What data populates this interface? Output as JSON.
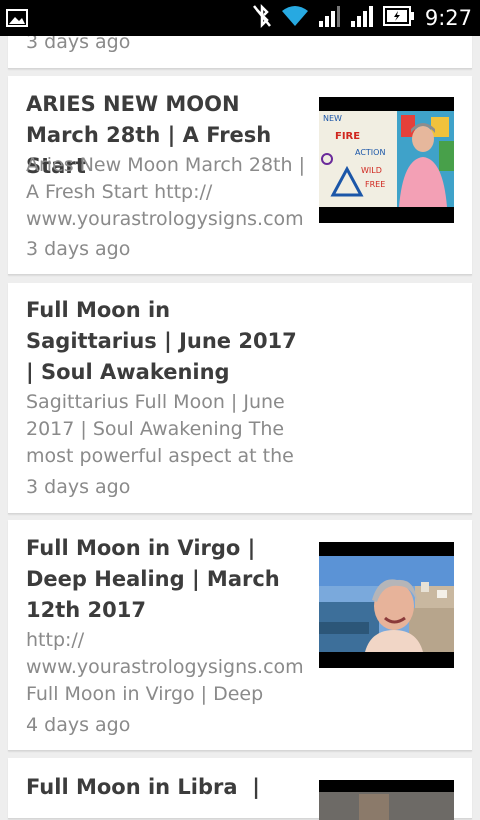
{
  "status_bar": {
    "time": "9:27",
    "icons": [
      "image-notification-icon",
      "bluetooth-off-icon",
      "wifi-icon",
      "signal-icon",
      "signal-icon",
      "battery-icon"
    ]
  },
  "feed": [
    {
      "title": "",
      "snippet": "",
      "time": "3 days ago"
    },
    {
      "title": "ARIES NEW MOON March 28th | A Fresh Start",
      "snippet": "Aries New Moon March 28th | A Fresh Start http:// www.yourastrologysigns.com",
      "time": "3 days ago",
      "thumb_text": [
        "NEW",
        "FIRE",
        "ACTION",
        "WILD",
        "FREE"
      ]
    },
    {
      "title": "Full Moon in Sagittarius | June 2017 | Soul Awakening",
      "snippet": "Sagittarius Full Moon | June 2017 | Soul Awakening The most powerful aspect at the",
      "time": "3 days ago"
    },
    {
      "title": "Full Moon in Virgo | Deep Healing | March 12th 2017",
      "snippet": "http:// www.yourastrologysigns.com Full Moon in Virgo | Deep",
      "time": "4 days ago"
    },
    {
      "title": "Full Moon in Libra  |",
      "snippet": "",
      "time": ""
    }
  ]
}
